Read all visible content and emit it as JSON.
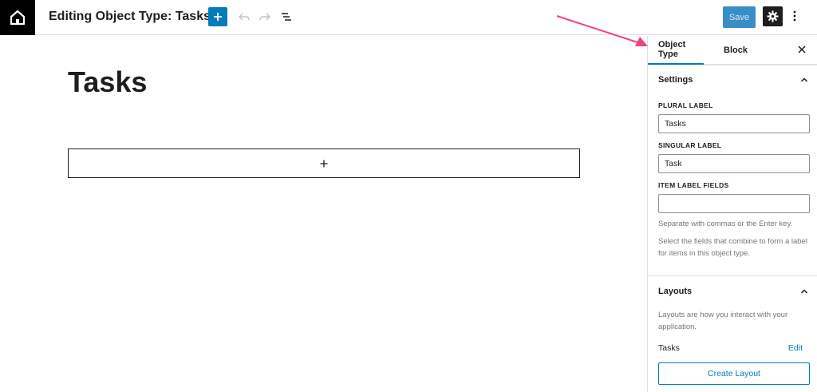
{
  "header": {
    "title": "Editing Object Type: Tasks",
    "save_label": "Save",
    "logo_icon": "home-icon",
    "add_icon": "plus-icon",
    "undo_icon": "undo-icon",
    "redo_icon": "redo-icon",
    "outline_icon": "list-view-icon",
    "settings_icon": "gear-icon",
    "more_icon": "more-vertical-icon"
  },
  "editor": {
    "title": "Tasks",
    "appender_icon": "plus-icon"
  },
  "sidebar": {
    "tabs": [
      {
        "label": "Object Type",
        "active": true
      },
      {
        "label": "Block",
        "active": false
      }
    ],
    "settings": {
      "heading": "Settings",
      "plural_label": "PLURAL LABEL",
      "plural_value": "Tasks",
      "singular_label": "SINGULAR LABEL",
      "singular_value": "Task",
      "item_label_fields_label": "ITEM LABEL FIELDS",
      "item_label_fields_value": "",
      "help_1": "Separate with commas or the Enter key.",
      "help_2": "Select the fields that combine to form a label for items in this object type."
    },
    "layouts": {
      "heading": "Layouts",
      "description": "Layouts are how you interact with your application.",
      "items": [
        {
          "name": "Tasks",
          "action": "Edit"
        }
      ],
      "create_label": "Create Layout"
    }
  },
  "colors": {
    "accent": "#007cba",
    "annotation_arrow": "#f0437a",
    "logo_bg": "#000000"
  }
}
